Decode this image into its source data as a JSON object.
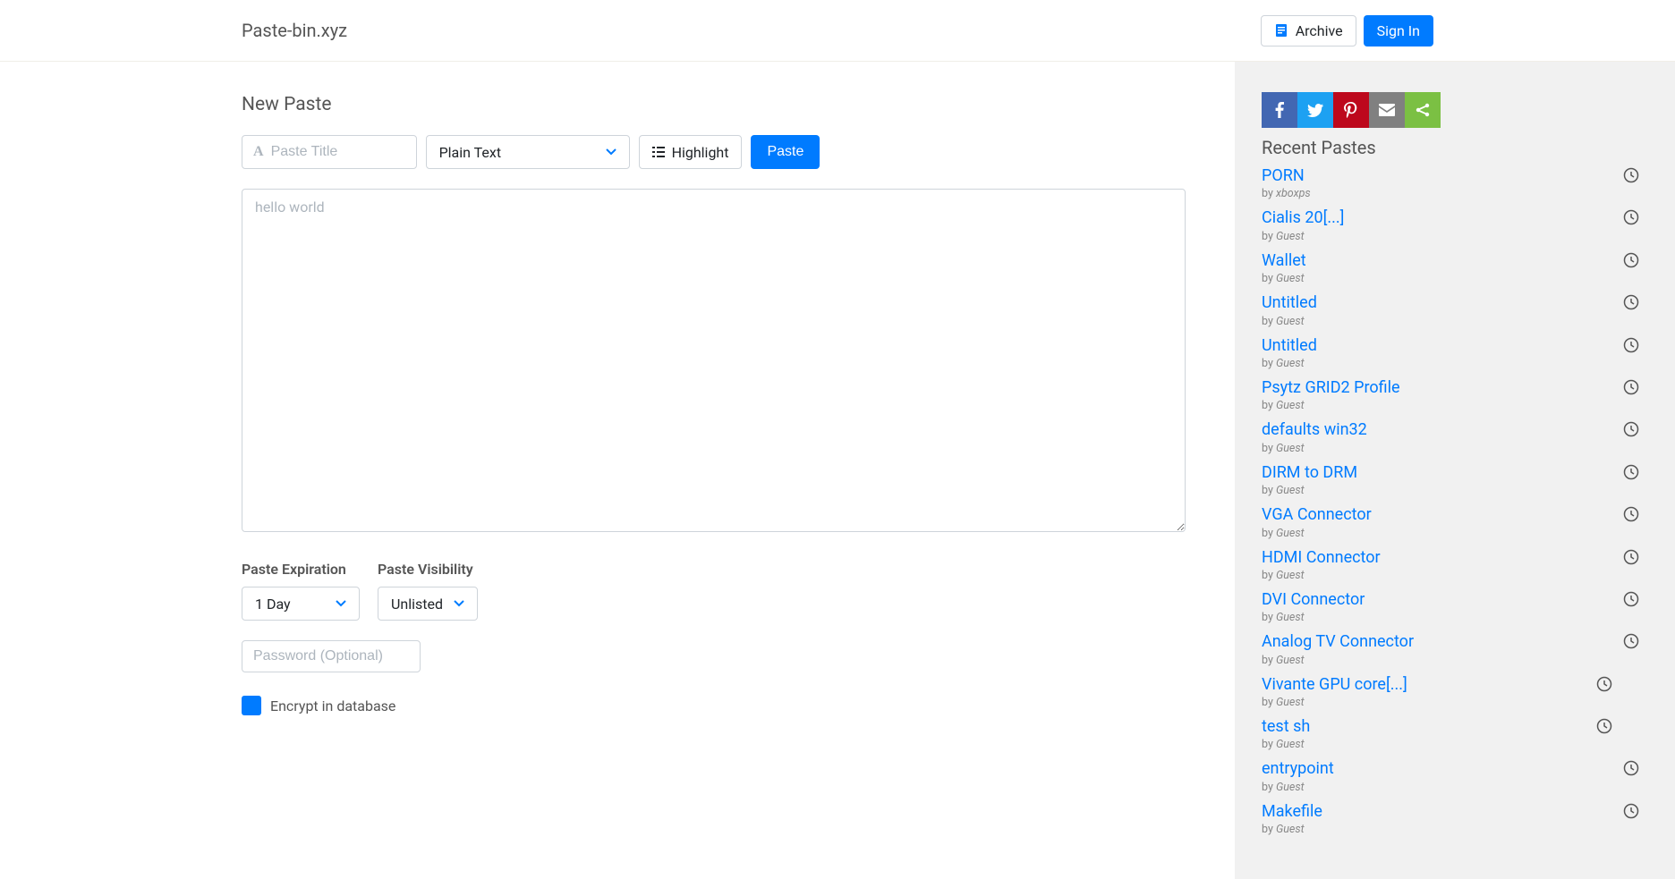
{
  "brand": "Paste-bin.xyz",
  "header": {
    "archive_label": "Archive",
    "signin_label": "Sign In"
  },
  "main": {
    "page_title": "New Paste",
    "title_placeholder": "Paste Title",
    "syntax_value": "Plain Text",
    "highlight_label": "Highlight",
    "paste_button": "Paste",
    "textarea_placeholder": "hello world",
    "expiration_label": "Paste Expiration",
    "expiration_value": "1 Day",
    "visibility_label": "Paste Visibility",
    "visibility_value": "Unlisted",
    "password_placeholder": "Password (Optional)",
    "encrypt_label": "Encrypt in database"
  },
  "sidebar": {
    "recent_title": "Recent Pastes",
    "by_prefix": "by ",
    "items": [
      {
        "title": "PORN",
        "author": "xboxps"
      },
      {
        "title": "Cialis 20[...]",
        "author": "Guest"
      },
      {
        "title": "Wallet",
        "author": "Guest"
      },
      {
        "title": "Untitled",
        "author": "Guest"
      },
      {
        "title": "Untitled",
        "author": "Guest"
      },
      {
        "title": "Psytz GRID2 Profile",
        "author": "Guest"
      },
      {
        "title": "defaults win32",
        "author": "Guest"
      },
      {
        "title": "DIRM to DRM",
        "author": "Guest"
      },
      {
        "title": "VGA Connector",
        "author": "Guest"
      },
      {
        "title": "HDMI Connector",
        "author": "Guest"
      },
      {
        "title": "DVI Connector",
        "author": "Guest"
      },
      {
        "title": "Analog TV Connector",
        "author": "Guest"
      },
      {
        "title": "Vivante GPU core[...]",
        "author": "Guest",
        "clock_offset": true
      },
      {
        "title": "test sh",
        "author": "Guest",
        "clock_offset": true
      },
      {
        "title": "entrypoint",
        "author": "Guest"
      },
      {
        "title": "Makefile",
        "author": "Guest"
      }
    ]
  }
}
